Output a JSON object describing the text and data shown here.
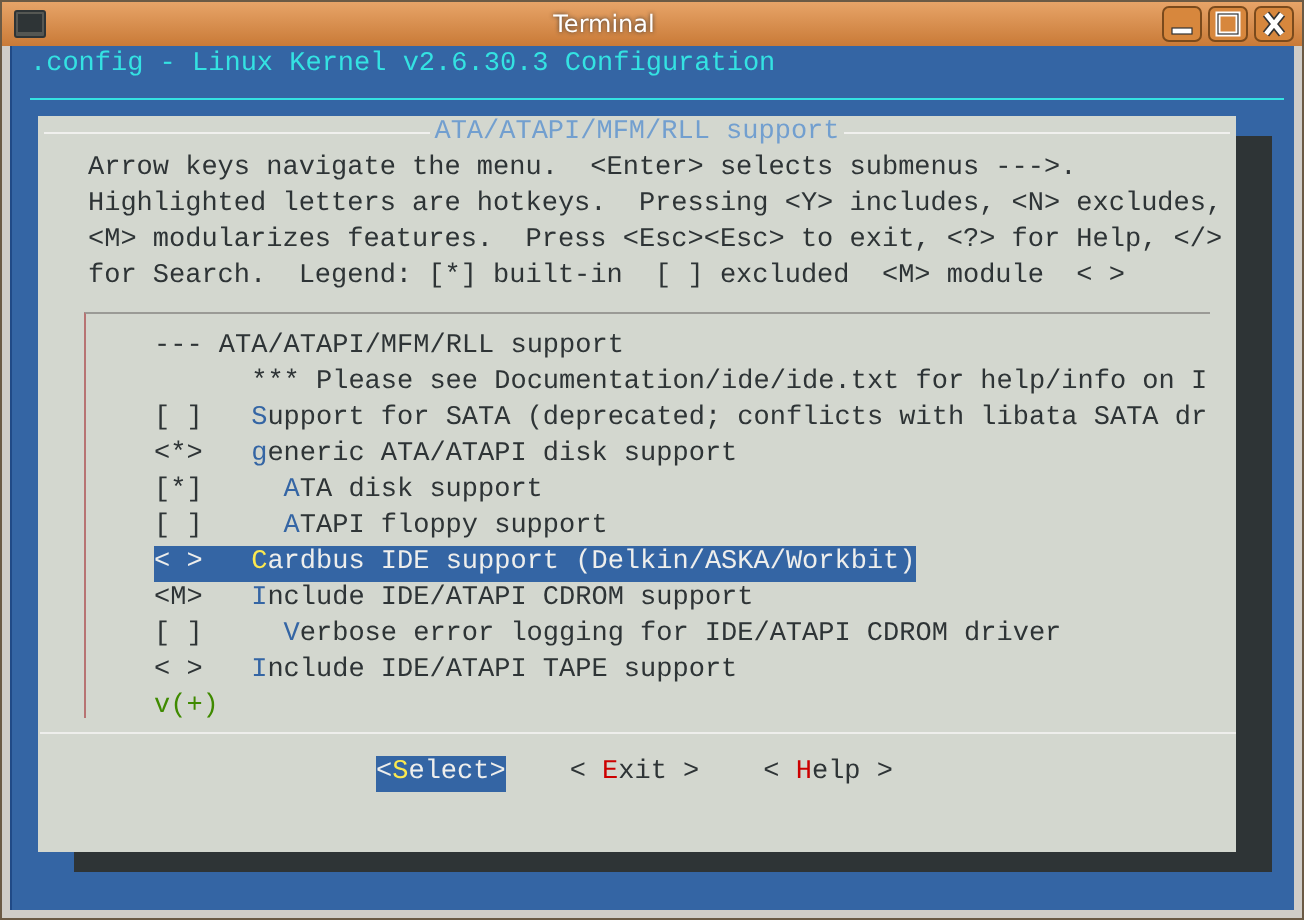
{
  "window": {
    "title": "Terminal"
  },
  "header": {
    "title": ".config - Linux Kernel v2.6.30.3 Configuration"
  },
  "dialog": {
    "title": "ATA/ATAPI/MFM/RLL support",
    "help_lines": [
      "Arrow keys navigate the menu.  <Enter> selects submenus --->.",
      "Highlighted letters are hotkeys.  Pressing <Y> includes, <N> excludes,",
      "<M> modularizes features.  Press <Esc><Esc> to exit, <?> for Help, </>",
      "for Search.  Legend: [*] built-in  [ ] excluded  <M> module  < >"
    ],
    "menu": [
      {
        "kind": "heading",
        "text": "--- ATA/ATAPI/MFM/RLL support",
        "selected": false
      },
      {
        "kind": "comment",
        "text": "*** Please see Documentation/ide/ide.txt for help/info on I",
        "selected": false
      },
      {
        "kind": "option",
        "prefix": "[ ]",
        "hotkey": "S",
        "text": "upport for SATA (deprecated; conflicts with libata SATA dr",
        "selected": false
      },
      {
        "kind": "option",
        "prefix": "<*>",
        "hotkey": "g",
        "text": "eneric ATA/ATAPI disk support",
        "selected": false,
        "children": [
          {
            "kind": "option",
            "prefix": "[*]",
            "hotkey": "A",
            "text": "TA disk support",
            "selected": false
          },
          {
            "kind": "option",
            "prefix": "[ ]",
            "hotkey": "A",
            "text": "TAPI floppy support",
            "selected": false
          }
        ]
      },
      {
        "kind": "option",
        "prefix": "< >",
        "hotkey": "C",
        "text": "ardbus IDE support (Delkin/ASKA/Workbit)",
        "selected": true
      },
      {
        "kind": "option",
        "prefix": "<M>",
        "hotkey": "I",
        "text": "nclude IDE/ATAPI CDROM support",
        "selected": false,
        "children": [
          {
            "kind": "option",
            "prefix": "[ ]",
            "hotkey": "V",
            "text": "erbose error logging for IDE/ATAPI CDROM driver",
            "selected": false
          }
        ]
      },
      {
        "kind": "option",
        "prefix": "< >",
        "hotkey": "I",
        "text": "nclude IDE/ATAPI TAPE support",
        "selected": false
      }
    ],
    "more_indicator": "v(+)",
    "buttons": [
      {
        "open": "<",
        "hotkey": "S",
        "text": "elect",
        "close": ">",
        "selected": true
      },
      {
        "open": "< ",
        "hotkey": "E",
        "text": "xit",
        "close": " >",
        "selected": false
      },
      {
        "open": "< ",
        "hotkey": "H",
        "text": "elp",
        "close": " >",
        "selected": false
      }
    ]
  }
}
